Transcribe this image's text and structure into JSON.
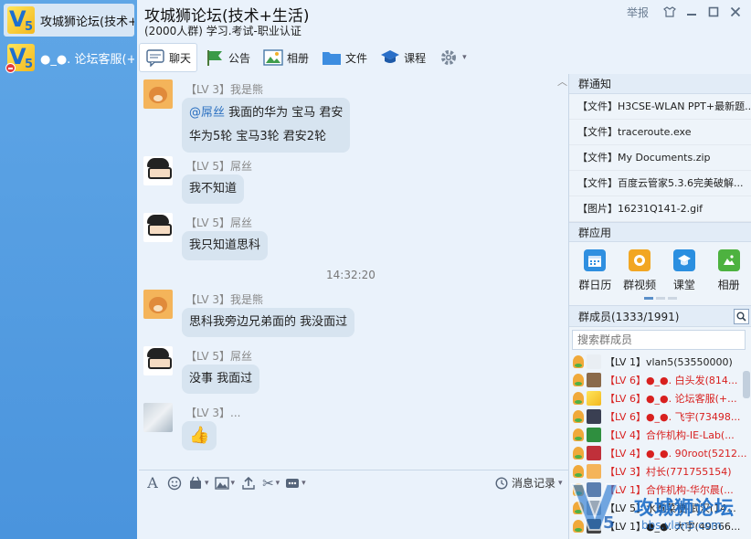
{
  "sessions": [
    {
      "name": "攻城狮论坛(技术+"
    },
    {
      "name": "●_●. 论坛客服(+"
    }
  ],
  "header": {
    "title": "攻城狮论坛(技术+生活)",
    "subtitle": "(2000人群) 学习.考试-职业认证",
    "report": "举报"
  },
  "toolbar": [
    {
      "label": "聊天",
      "icon": "chat-bubble-icon"
    },
    {
      "label": "公告",
      "icon": "megaphone-icon"
    },
    {
      "label": "相册",
      "icon": "photo-album-icon"
    },
    {
      "label": "文件",
      "icon": "folder-icon"
    },
    {
      "label": "课程",
      "icon": "graduation-cap-icon"
    },
    {
      "label": "",
      "icon": "gear-icon"
    }
  ],
  "messages": [
    {
      "sender": "【LV 3】我是熊",
      "mention": "@屌丝",
      "line1": " 我面的华为  宝马  君安",
      "line2": "华为5轮  宝马3轮  君安2轮",
      "avatar": "bear-avatar"
    },
    {
      "sender": "【LV 5】屌丝",
      "text": "我不知道",
      "avatar": "glasses-boy-avatar"
    },
    {
      "sender": "【LV 5】屌丝",
      "text": "我只知道思科",
      "avatar": "glasses-boy-avatar"
    },
    {
      "sender": "【LV 3】我是熊",
      "text": "思科我旁边兄弟面的   我没面过",
      "avatar": "bear-avatar"
    },
    {
      "sender": "【LV 5】屌丝",
      "text": "没事 我面过",
      "avatar": "glasses-boy-avatar"
    },
    {
      "sender": "【LV 3】...",
      "text": "👍",
      "avatar": "photo-avatar"
    }
  ],
  "timestamp": "14:32:20",
  "input_toolbar": {
    "history": "消息记录"
  },
  "notices": {
    "title": "群通知",
    "items": [
      "【文件】H3CSE-WLAN PPT+最新题...",
      "【文件】traceroute.exe",
      "【文件】My Documents.zip",
      "【文件】百度云管家5.3.6完美破解...",
      "【图片】16231Q141-2.gif"
    ]
  },
  "apps": {
    "title": "群应用",
    "items": [
      {
        "label": "群日历",
        "icon": "calendar-icon",
        "color": "#2f8fe0"
      },
      {
        "label": "群视频",
        "icon": "video-icon",
        "color": "#f2a623"
      },
      {
        "label": "课堂",
        "icon": "classroom-icon",
        "color": "#2b8fe0"
      },
      {
        "label": "相册",
        "icon": "album-icon",
        "color": "#4db23f"
      }
    ]
  },
  "members": {
    "title": "群成员(1333/1991)",
    "search_placeholder": "搜索群成员",
    "items": [
      {
        "text": "【LV 1】vlan5(53550000)",
        "color": "black"
      },
      {
        "text": "【LV 6】●_●. 白头发(814...",
        "color": "red"
      },
      {
        "text": "【LV 6】●_●. 论坛客服(+...",
        "color": "red"
      },
      {
        "text": "【LV 6】●_●. 飞宇(73498...",
        "color": "red"
      },
      {
        "text": "【LV 4】合作机构-IE-Lab(...",
        "color": "red"
      },
      {
        "text": "【LV 4】●_●. 90root(5212...",
        "color": "red"
      },
      {
        "text": "【LV 3】村长(771755154)",
        "color": "red"
      },
      {
        "text": "【LV 1】合作机构-华尔晨(...",
        "color": "red"
      },
      {
        "text": "【LV 5】水煮菜梗-武汉(14...",
        "color": "black"
      },
      {
        "text": "【LV 1】●_●. 大宇(49366...",
        "color": "black"
      }
    ]
  },
  "watermark": {
    "title": "攻城狮论坛",
    "url": "bbs.vlan5.com"
  }
}
